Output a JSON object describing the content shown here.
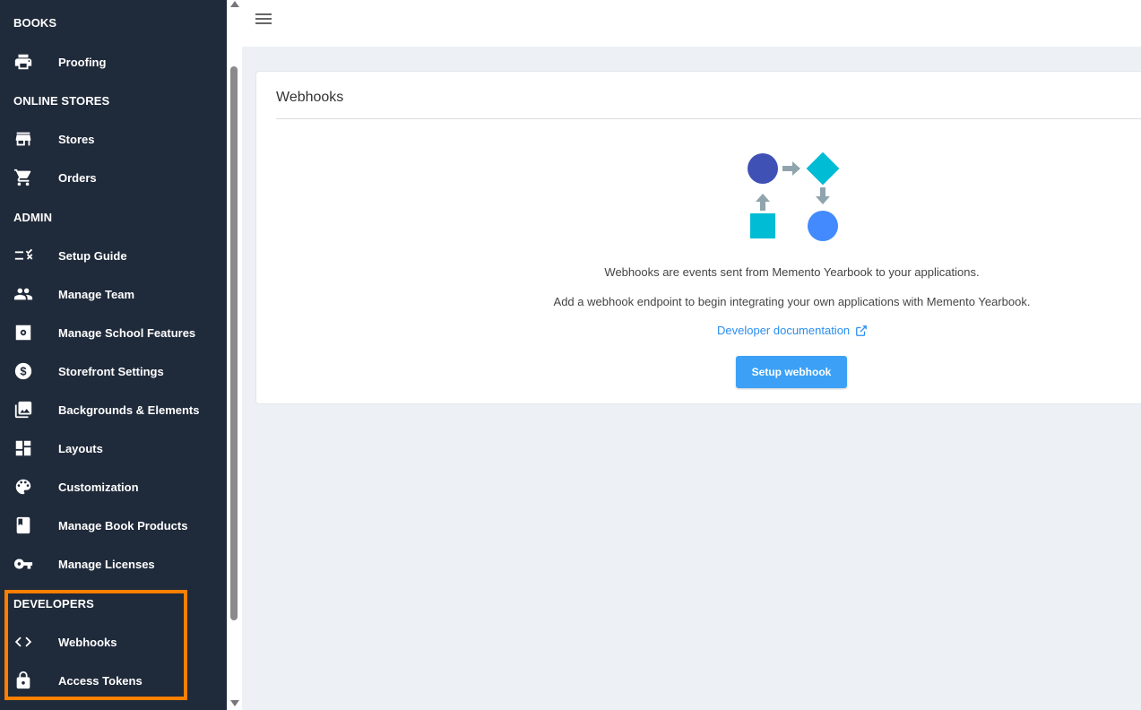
{
  "sidebar": {
    "sections": {
      "books": "BOOKS",
      "online_stores": "ONLINE STORES",
      "admin": "ADMIN",
      "developers": "DEVELOPERS"
    },
    "items": {
      "proofing": {
        "label": "Proofing",
        "icon": "printer-icon"
      },
      "stores": {
        "label": "Stores",
        "icon": "store-icon"
      },
      "orders": {
        "label": "Orders",
        "icon": "cart-icon"
      },
      "setup_guide": {
        "label": "Setup Guide",
        "icon": "checklist-icon"
      },
      "manage_team": {
        "label": "Manage Team",
        "icon": "people-icon"
      },
      "manage_school_features": {
        "label": "Manage School Features",
        "icon": "gear-icon"
      },
      "storefront_settings": {
        "label": "Storefront Settings",
        "icon": "dollar-icon"
      },
      "backgrounds_elements": {
        "label": "Backgrounds & Elements",
        "icon": "photos-icon"
      },
      "layouts": {
        "label": "Layouts",
        "icon": "dashboard-icon"
      },
      "customization": {
        "label": "Customization",
        "icon": "palette-icon"
      },
      "manage_book_products": {
        "label": "Manage Book Products",
        "icon": "book-icon"
      },
      "manage_licenses": {
        "label": "Manage Licenses",
        "icon": "key-icon"
      },
      "webhooks": {
        "label": "Webhooks",
        "icon": "code-icon"
      },
      "access_tokens": {
        "label": "Access Tokens",
        "icon": "lock-icon"
      }
    }
  },
  "colors": {
    "sidebar_bg": "#1f2a3a",
    "highlight": "#ff7f00",
    "accent": "#3ca1f6",
    "link": "#2a8ef0"
  },
  "main": {
    "card": {
      "title": "Webhooks",
      "message_1": "Webhooks are events sent from Memento Yearbook to your applications.",
      "message_2": "Add a webhook endpoint to begin integrating your own applications with Memento Yearbook.",
      "doc_link": "Developer documentation",
      "setup_button": "Setup webhook"
    }
  }
}
